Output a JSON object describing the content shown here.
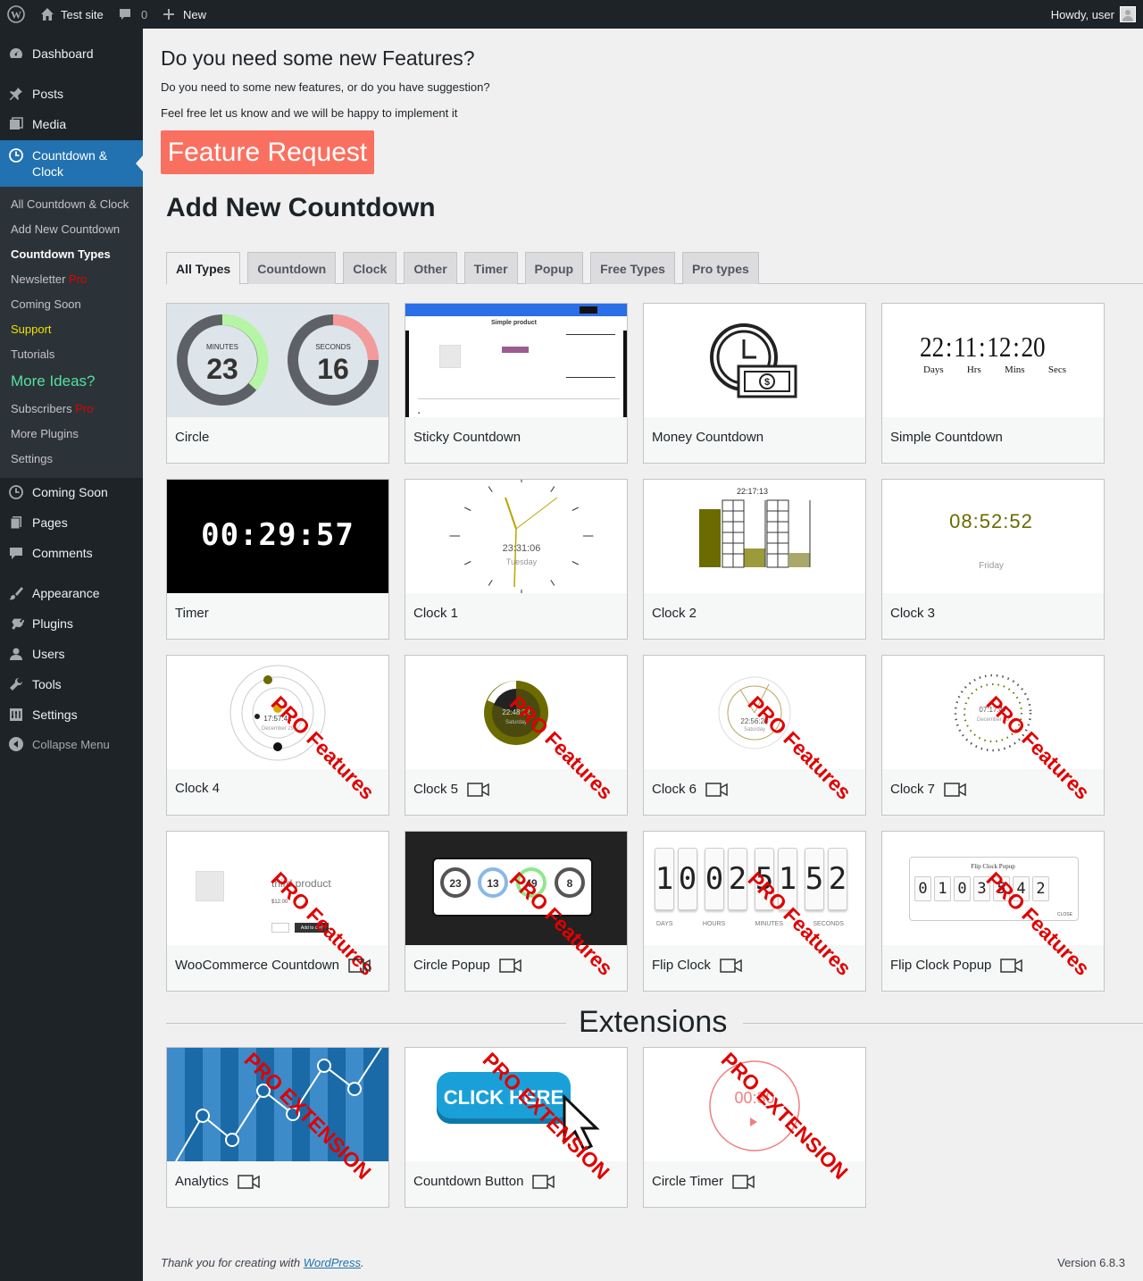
{
  "adminbar": {
    "site": "Test site",
    "comments": "0",
    "new": "New",
    "howdy": "Howdy, user"
  },
  "sidebar": {
    "items": [
      {
        "label": "Dashboard",
        "icon": "dashboard-icon"
      },
      {
        "label": "Posts",
        "icon": "pin-icon"
      },
      {
        "label": "Media",
        "icon": "media-icon"
      },
      {
        "label": "Countdown & Clock",
        "icon": "clock-icon"
      },
      {
        "label": "Coming Soon",
        "icon": "clock-icon"
      },
      {
        "label": "Pages",
        "icon": "pages-icon"
      },
      {
        "label": "Comments",
        "icon": "comment-icon"
      },
      {
        "label": "Appearance",
        "icon": "brush-icon"
      },
      {
        "label": "Plugins",
        "icon": "plug-icon"
      },
      {
        "label": "Users",
        "icon": "user-icon"
      },
      {
        "label": "Tools",
        "icon": "wrench-icon"
      },
      {
        "label": "Settings",
        "icon": "settings-icon"
      },
      {
        "label": "Collapse Menu",
        "icon": "collapse-icon"
      }
    ],
    "submenu": [
      {
        "label": "All Countdown & Clock"
      },
      {
        "label": "Add New Countdown"
      },
      {
        "label": "Countdown Types"
      },
      {
        "label": "Newsletter",
        "badge": "Pro"
      },
      {
        "label": "Coming Soon"
      },
      {
        "label": "Support"
      },
      {
        "label": "Tutorials"
      },
      {
        "label": "More Ideas?"
      },
      {
        "label": "Subscribers",
        "badge": "Pro"
      },
      {
        "label": "More Plugins"
      },
      {
        "label": "Settings"
      }
    ],
    "countdown_line1": "Countdown &",
    "countdown_line2": "Clock"
  },
  "features": {
    "title": "Do you need some new Features?",
    "line1": "Do you need to some new features, or do you have suggestion?",
    "line2": "Feel free let us know and we will be happy to implement it",
    "button": "Feature Request"
  },
  "page_title": "Add New Countdown",
  "tabs": [
    "All Types",
    "Countdown",
    "Clock",
    "Other",
    "Timer",
    "Popup",
    "Free Types",
    "Pro types"
  ],
  "ribbon_pro": "PRO Features",
  "ribbon_ext": "PRO EXTENSION",
  "cards": [
    {
      "name": "Circle",
      "pro": false,
      "video": false
    },
    {
      "name": "Sticky Countdown",
      "pro": false,
      "video": false
    },
    {
      "name": "Money Countdown",
      "pro": false,
      "video": false
    },
    {
      "name": "Simple Countdown",
      "pro": false,
      "video": false
    },
    {
      "name": "Timer",
      "pro": false,
      "video": false
    },
    {
      "name": "Clock 1",
      "pro": false,
      "video": false
    },
    {
      "name": "Clock 2",
      "pro": false,
      "video": false
    },
    {
      "name": "Clock 3",
      "pro": false,
      "video": false
    },
    {
      "name": "Clock 4",
      "pro": true,
      "video": false
    },
    {
      "name": "Clock 5",
      "pro": true,
      "video": true
    },
    {
      "name": "Clock 6",
      "pro": true,
      "video": true
    },
    {
      "name": "Clock 7",
      "pro": true,
      "video": true
    },
    {
      "name": "WooCommerce Countdown",
      "pro": true,
      "video": true
    },
    {
      "name": "Circle Popup",
      "pro": true,
      "video": true
    },
    {
      "name": "Flip Clock",
      "pro": true,
      "video": true
    },
    {
      "name": "Flip Clock Popup",
      "pro": true,
      "video": true
    }
  ],
  "previews": {
    "circle": {
      "minutes_label": "MINUTES",
      "minutes": "23",
      "seconds_label": "SECONDS",
      "seconds": "16"
    },
    "simple": {
      "d": "22",
      "h": "11",
      "m": "12",
      "s": "20",
      "dl": "Days",
      "hl": "Hrs",
      "ml": "Mins",
      "sl": "Secs"
    },
    "timer": "00:29:57",
    "clock1": {
      "time": "23:31:06",
      "day": "Tuesday"
    },
    "clock2": "22:17:13",
    "clock3": {
      "time": "08:52:52",
      "day": "Friday"
    },
    "clock4": {
      "time": "17:57:41",
      "date": "December 29"
    },
    "clock5": {
      "time": "22:48:32",
      "day": "Saturday"
    },
    "clock6": {
      "time": "22:56:28",
      "day": "Saturday"
    },
    "clock7": {
      "time": "07:17:47",
      "date": "December 29"
    },
    "sticky": {
      "product": "Simple product"
    },
    "woo": {
      "product": "third product",
      "price": "$12.00",
      "btn": "Add to cart"
    },
    "popup": [
      "23",
      "13",
      "49",
      "8"
    ],
    "flip": [
      "1",
      "0",
      "0",
      "2",
      "5",
      "1",
      "5",
      "2"
    ],
    "flip_labels": [
      "DAYS",
      "HOURS",
      "MINUTES",
      "SECONDS"
    ],
    "flippop": {
      "title": "Flip Clock Popup",
      "digits": [
        "0",
        "1",
        "0",
        "3",
        "5",
        "4",
        "2"
      ],
      "close": "CLOSE"
    }
  },
  "extensions": {
    "title": "Extensions",
    "items": [
      {
        "name": "Analytics"
      },
      {
        "name": "Countdown Button",
        "preview_text": "CLICK HERE"
      },
      {
        "name": "Circle Timer",
        "preview_text": "00:30"
      }
    ]
  },
  "footer": {
    "text": "Thank you for creating with ",
    "link": "WordPress",
    "end": ".",
    "version": "Version 6.8.3"
  }
}
